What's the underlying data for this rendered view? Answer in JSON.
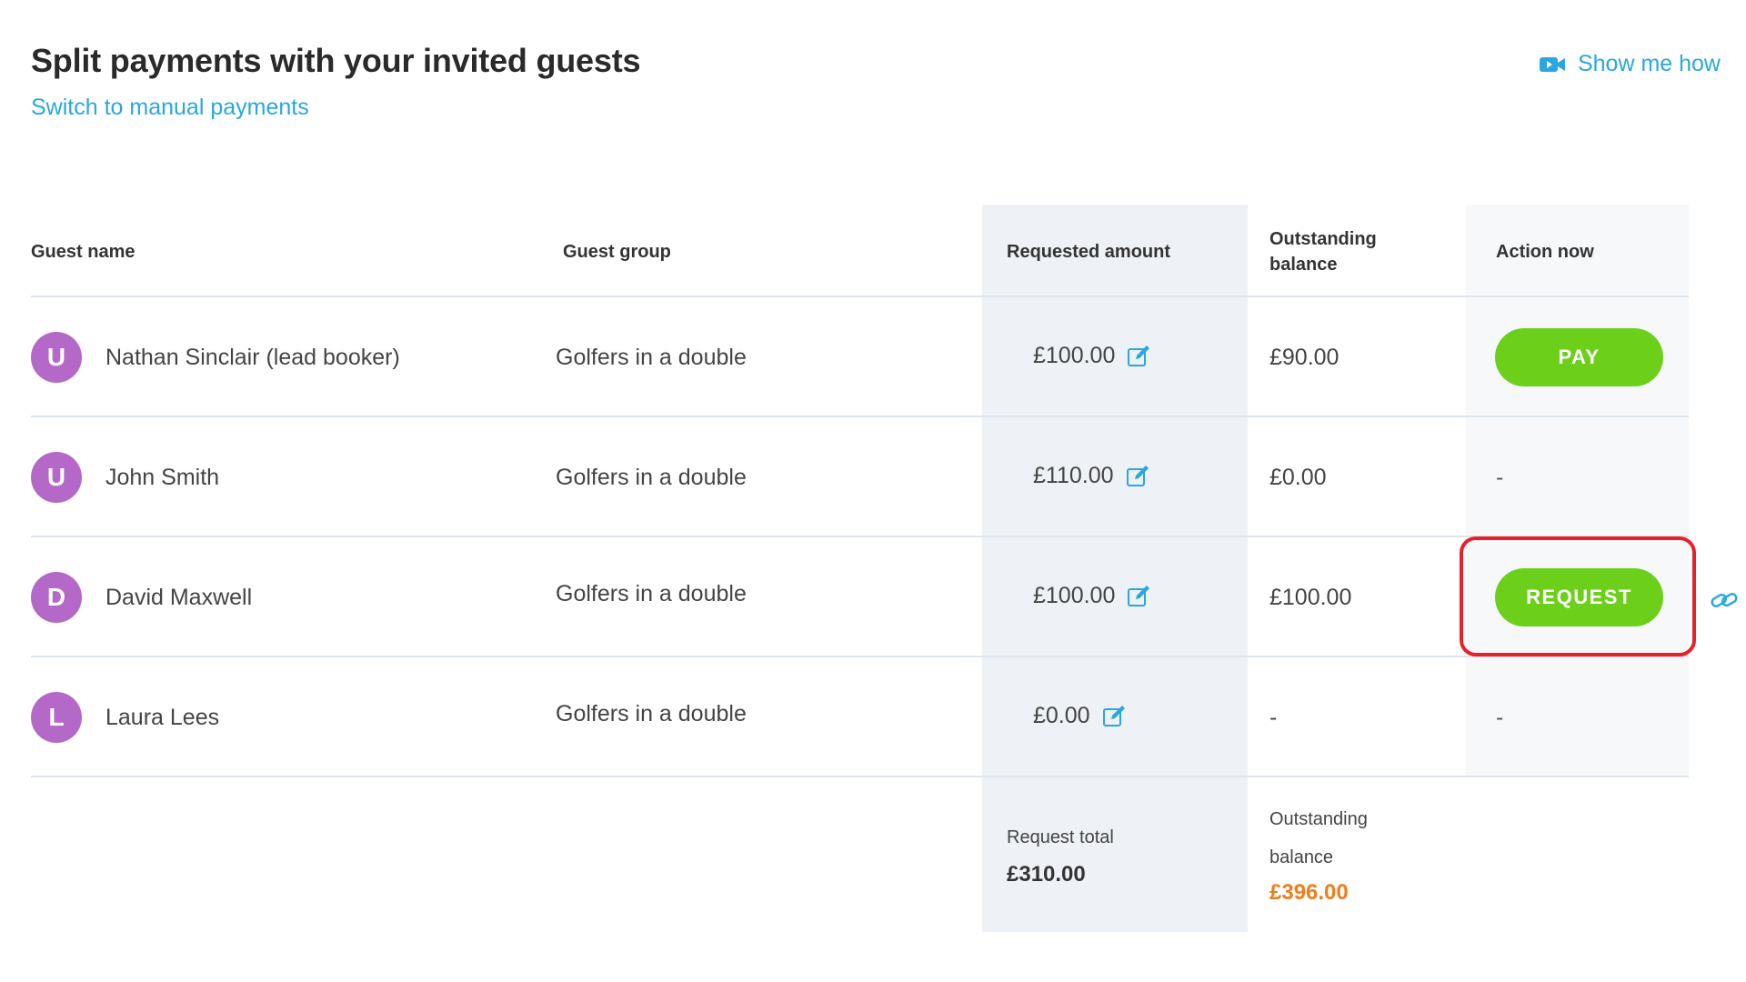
{
  "header": {
    "title": "Split payments with your invited guests",
    "switch_link": "Switch to manual payments",
    "show_me_how": "Show me how"
  },
  "table": {
    "columns": {
      "guest_name": "Guest name",
      "guest_group": "Guest group",
      "requested_amount": "Requested amount",
      "outstanding_balance_line1": "Outstanding",
      "outstanding_balance_line2": "balance",
      "action_now": "Action now"
    },
    "rows": [
      {
        "initial": "U",
        "name": "Nathan Sinclair (lead booker)",
        "group": "Golfers in a double",
        "requested": "£100.00",
        "outstanding": "£90.00",
        "action": "PAY"
      },
      {
        "initial": "U",
        "name": "John Smith",
        "group": "Golfers in a double",
        "requested": "£110.00",
        "outstanding": "£0.00",
        "action": "-"
      },
      {
        "initial": "D",
        "name": "David Maxwell",
        "group": "Golfers in a double",
        "requested": "£100.00",
        "outstanding": "£100.00",
        "action": "REQUEST"
      },
      {
        "initial": "L",
        "name": "Laura Lees",
        "group": "Golfers in a double",
        "requested": "£0.00",
        "outstanding": "-",
        "action": "-"
      }
    ],
    "totals": {
      "request_total_label": "Request total",
      "request_total_value": "£310.00",
      "outstanding_label_line1": "Outstanding",
      "outstanding_label_line2": "balance",
      "outstanding_value": "£396.00"
    }
  },
  "colors": {
    "accent_link": "#2aa7de",
    "button_green": "#6ccf1a",
    "avatar_purple": "#b469c9",
    "outstanding_orange": "#f07d1c",
    "highlight_red": "#e8202a"
  },
  "icons": {
    "video": "video-icon",
    "edit": "edit-icon",
    "link": "link-icon"
  }
}
